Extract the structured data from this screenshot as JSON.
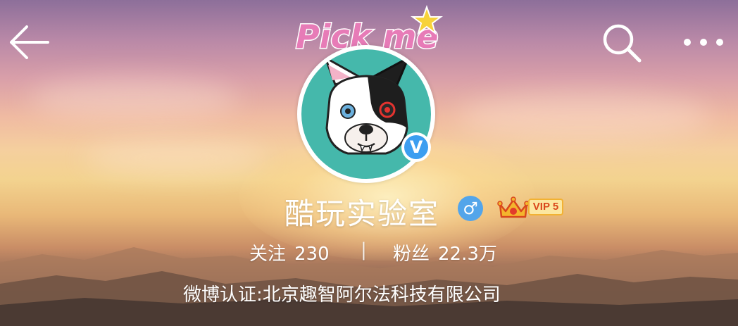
{
  "header": {
    "back_icon": "arrow-left-icon",
    "search_icon": "search-icon",
    "more_icon": "more-horizontal-icon"
  },
  "avatar": {
    "decoration_text": "Pick me",
    "verified_icon": "verified-v-icon",
    "verified_text": "V"
  },
  "profile": {
    "nickname": "酷玩实验室",
    "gender_icon": "male-icon",
    "gender_symbol": "♂",
    "vip_label": "VIP 5",
    "vip_icon": "crown-icon"
  },
  "stats": {
    "follow_label": "关注",
    "follow_count": "230",
    "separator": "|",
    "fans_label": "粉丝",
    "fans_count": "22.3万"
  },
  "verification": {
    "text": "微博认证:北京趣智阿尔法科技有限公司"
  },
  "colors": {
    "avatar_bg": "#45b8ab",
    "verified_blue": "#3c9ef0",
    "gender_blue": "#53a5ea",
    "vip_gold": "#f2b233"
  }
}
